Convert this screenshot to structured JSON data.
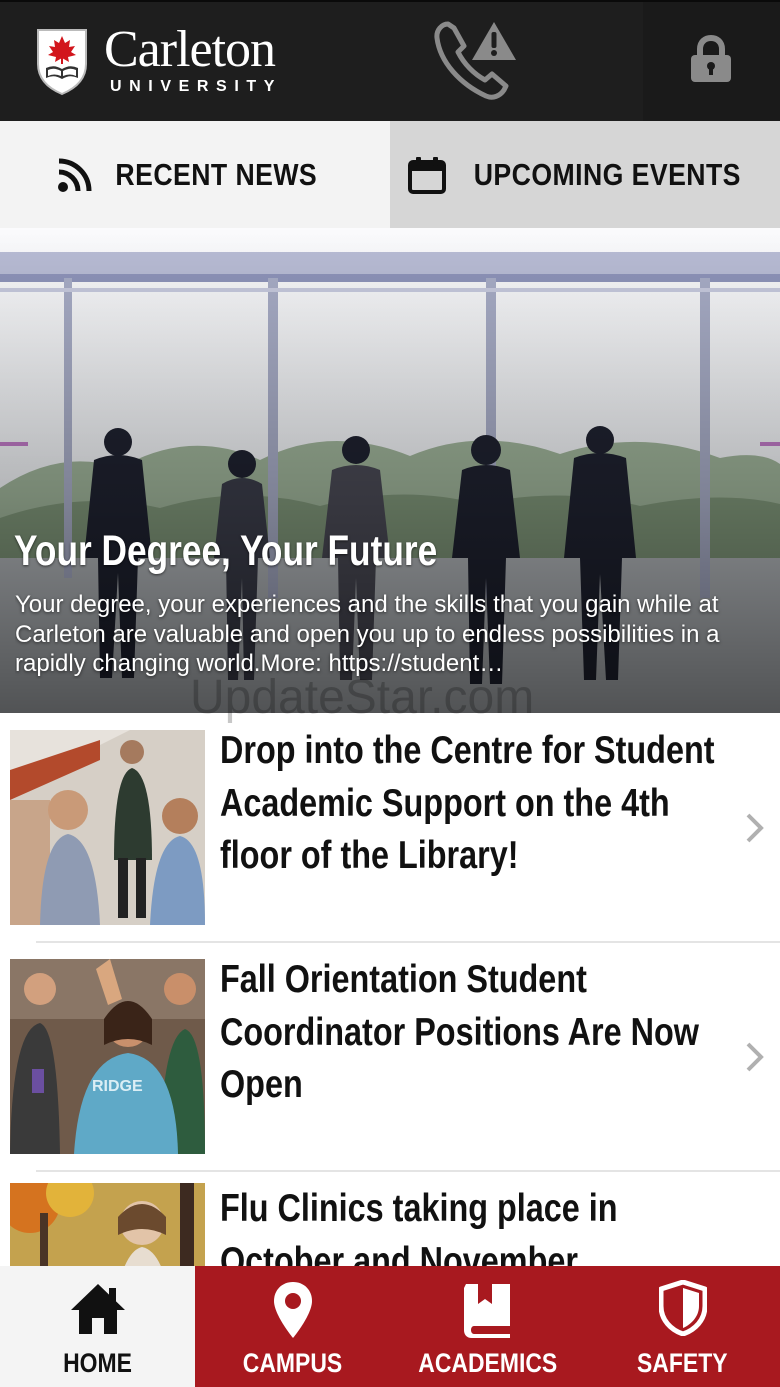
{
  "header": {
    "logo_word": "Carleton",
    "logo_sub": "UNIVERSITY",
    "icons": [
      "carleton-shield-logo",
      "phone-alert-icon",
      "lock-icon"
    ]
  },
  "tabs": [
    {
      "label": "RECENT NEWS",
      "icon": "rss-icon",
      "selected": true
    },
    {
      "label": "UPCOMING EVENTS",
      "icon": "calendar-icon",
      "selected": false
    }
  ],
  "hero": {
    "title": "Your Degree, Your Future",
    "body": "Your degree, your experiences and the skills that you gain while at Carleton are valuable and open you up to endless possibilities in a rapidly changing world.More: https://student…"
  },
  "watermark": "UpdateStar.com",
  "news": [
    {
      "title": "Drop into the Centre for Student Academic Support on the 4th floor of the Library!"
    },
    {
      "title": "Fall Orientation Student Coordinator Positions Are Now Open"
    },
    {
      "title": "Flu Clinics taking place in October and November"
    }
  ],
  "bottom_nav": [
    {
      "label": "HOME",
      "icon": "home-icon",
      "active": true
    },
    {
      "label": "CAMPUS",
      "icon": "map-pin-icon",
      "active": false
    },
    {
      "label": "ACADEMICS",
      "icon": "book-icon",
      "active": false
    },
    {
      "label": "SAFETY",
      "icon": "shield-icon",
      "active": false
    }
  ],
  "colors": {
    "header_bg": "#1e1e1e",
    "brand_red": "#a8191f",
    "tab_selected_bg": "#f3f3f3",
    "tab_unselected_bg": "#d6d6d6"
  }
}
